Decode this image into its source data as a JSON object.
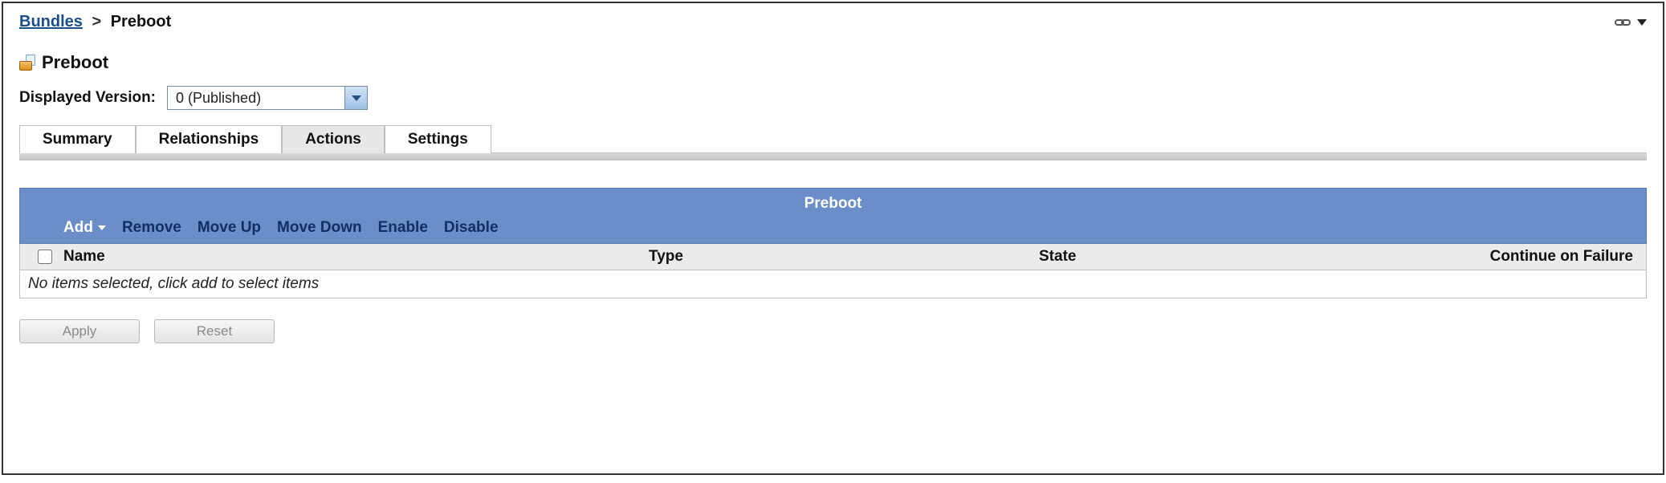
{
  "breadcrumb": {
    "root_label": "Bundles",
    "separator": ">",
    "current_label": "Preboot"
  },
  "page": {
    "title": "Preboot"
  },
  "version": {
    "label": "Displayed Version:",
    "selected": "0 (Published)"
  },
  "tabs": {
    "items": [
      {
        "label": "Summary"
      },
      {
        "label": "Relationships"
      },
      {
        "label": "Actions"
      },
      {
        "label": "Settings"
      }
    ],
    "active_index": 2
  },
  "panel": {
    "title": "Preboot",
    "toolbar": {
      "add_label": "Add",
      "remove_label": "Remove",
      "moveup_label": "Move Up",
      "movedown_label": "Move Down",
      "enable_label": "Enable",
      "disable_label": "Disable"
    },
    "columns": {
      "name": "Name",
      "type": "Type",
      "state": "State",
      "continue_on_failure": "Continue on Failure"
    },
    "empty_message": "No items selected, click add to select items"
  },
  "buttons": {
    "apply": "Apply",
    "reset": "Reset"
  }
}
